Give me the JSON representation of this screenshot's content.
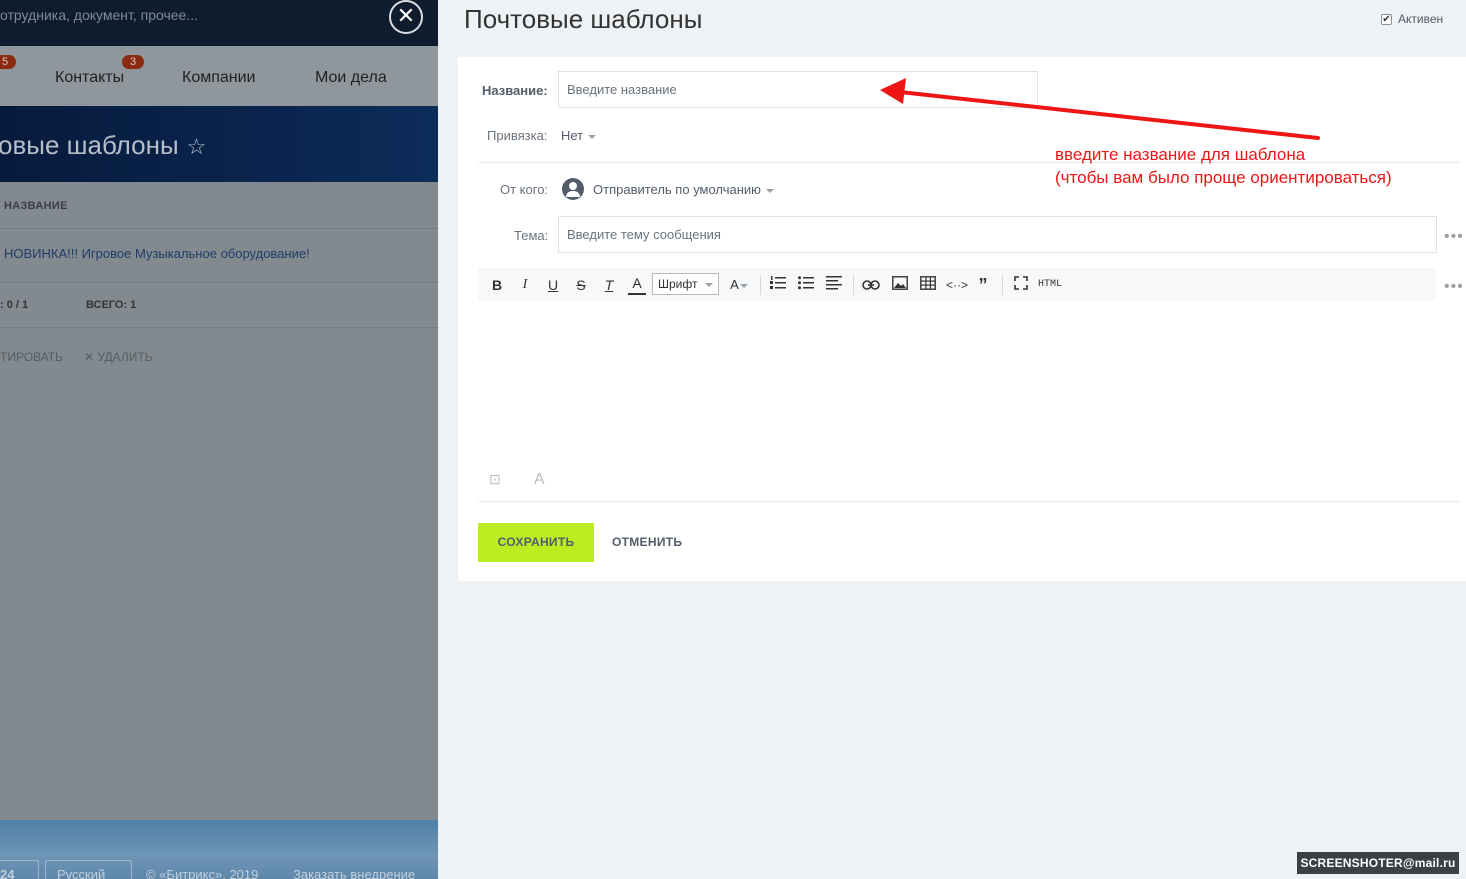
{
  "background": {
    "search_placeholder": "отрудника, документ, прочее...",
    "close_symbol": "✕",
    "menu": [
      {
        "label": "",
        "badge": "5"
      },
      {
        "label": "Контакты",
        "badge": "3"
      },
      {
        "label": "Компании"
      },
      {
        "label": "Мои дела"
      }
    ],
    "page_title": "овые шаблоны",
    "star_symbol": "☆",
    "grid": {
      "column_header": "НАЗВАНИЕ",
      "row_text": "НОВИНКА!!! Игровое Музыкальное оборудование!",
      "selected_stat": ": 0 / 1",
      "total_stat": "ВСЕГО: 1",
      "action_edit": "ТИРОВАТЬ",
      "action_delete": "✕ УДАЛИТЬ"
    },
    "footer": {
      "logo": "24",
      "language": "Русский",
      "copyright": "© «Битрикс», 2019",
      "order_link": "Заказать внедрение"
    }
  },
  "panel": {
    "title": "Почтовые шаблоны",
    "active_label": "Активен",
    "active_checked": true,
    "form": {
      "name_label": "Название:",
      "name_placeholder": "Введите название",
      "binding_label": "Привязка:",
      "binding_value": "Нет",
      "from_label": "От кого:",
      "from_value": "Отправитель по умолчанию",
      "subject_label": "Тема:",
      "subject_placeholder": "Введите тему сообщения"
    },
    "toolbar": {
      "bold": "B",
      "italic": "I",
      "underline": "U",
      "strike": "S",
      "clear_format": "T",
      "font_color": "A",
      "font_select": "Шрифт",
      "font_size": "A",
      "html": "HTML"
    },
    "buttons": {
      "save": "СОХРАНИТЬ",
      "cancel": "ОТМЕНИТЬ"
    }
  },
  "annotation": {
    "line1": "введите название для шаблона",
    "line2": "(чтобы вам было проще ориентироваться)",
    "color": "#ee1515"
  },
  "watermark": "SCREENSHOTER@mail.ru"
}
